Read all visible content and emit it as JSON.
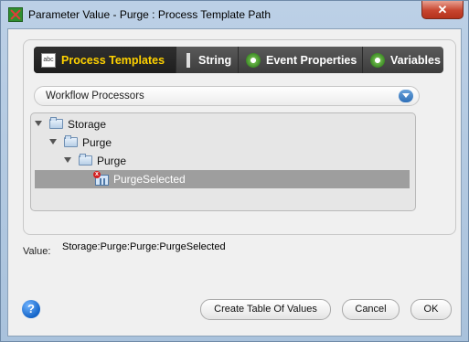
{
  "window": {
    "title": "Parameter Value - Purge : Process Template Path",
    "close_label": "✕"
  },
  "tabs": [
    {
      "label": "Process Templates",
      "icon": "abc-icon",
      "active": true
    },
    {
      "label": "String",
      "icon": "string-icon",
      "active": false
    },
    {
      "label": "Event Properties",
      "icon": "gear-icon",
      "active": false
    },
    {
      "label": "Variables",
      "icon": "gear-icon",
      "active": false
    }
  ],
  "dropdown": {
    "selected": "Workflow Processors"
  },
  "tree": {
    "nodes": [
      {
        "label": "Storage",
        "type": "folder",
        "expanded": true
      },
      {
        "label": "Purge",
        "type": "folder",
        "expanded": true
      },
      {
        "label": "Purge",
        "type": "folder",
        "expanded": true
      },
      {
        "label": "PurgeSelected",
        "type": "process",
        "selected": true
      }
    ]
  },
  "value": {
    "label": "Value:",
    "text": "Storage:Purge:Purge:PurgeSelected"
  },
  "buttons": {
    "help": "?",
    "create_table": "Create Table Of Values",
    "cancel": "Cancel",
    "ok": "OK"
  },
  "colors": {
    "active_tab_text": "#ffd200",
    "tab_bar": "#3c3c3c",
    "selected_row": "#9e9e9e"
  }
}
